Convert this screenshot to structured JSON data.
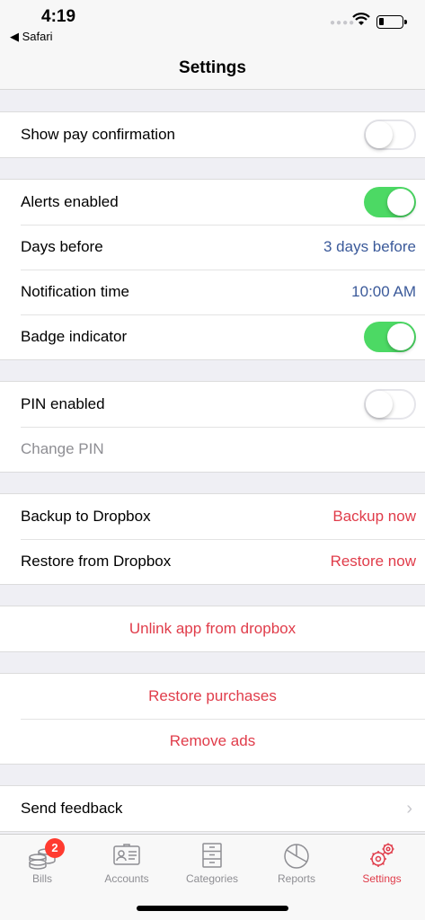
{
  "status_bar": {
    "time": "4:19",
    "back_app": "◀ Safari"
  },
  "nav": {
    "title": "Settings"
  },
  "sections": {
    "pay": {
      "show_pay_confirmation": "Show pay confirmation",
      "show_pay_confirmation_on": false
    },
    "alerts": {
      "alerts_enabled": "Alerts enabled",
      "alerts_enabled_on": true,
      "days_before": "Days before",
      "days_before_value": "3 days before",
      "notification_time": "Notification time",
      "notification_time_value": "10:00 AM",
      "badge_indicator": "Badge indicator",
      "badge_indicator_on": true
    },
    "pin": {
      "pin_enabled": "PIN enabled",
      "pin_enabled_on": false,
      "change_pin": "Change PIN"
    },
    "dropbox": {
      "backup": "Backup to Dropbox",
      "backup_action": "Backup now",
      "restore": "Restore from Dropbox",
      "restore_action": "Restore now"
    },
    "unlink": {
      "label": "Unlink app from dropbox"
    },
    "purchases": {
      "restore_purchases": "Restore purchases",
      "remove_ads": "Remove ads"
    },
    "feedback": {
      "send_feedback": "Send feedback"
    }
  },
  "tab_bar": {
    "tabs": [
      {
        "label": "Bills",
        "icon": "coins-icon",
        "badge": "2",
        "active": false
      },
      {
        "label": "Accounts",
        "icon": "id-card-icon",
        "active": false
      },
      {
        "label": "Categories",
        "icon": "cabinet-icon",
        "active": false
      },
      {
        "label": "Reports",
        "icon": "pie-chart-icon",
        "active": false
      },
      {
        "label": "Settings",
        "icon": "gears-icon",
        "active": true
      }
    ]
  },
  "colors": {
    "accent": "#e03c4a",
    "link_blue": "#3b5a9a",
    "toggle_on": "#4cd964",
    "badge": "#ff3b30"
  }
}
